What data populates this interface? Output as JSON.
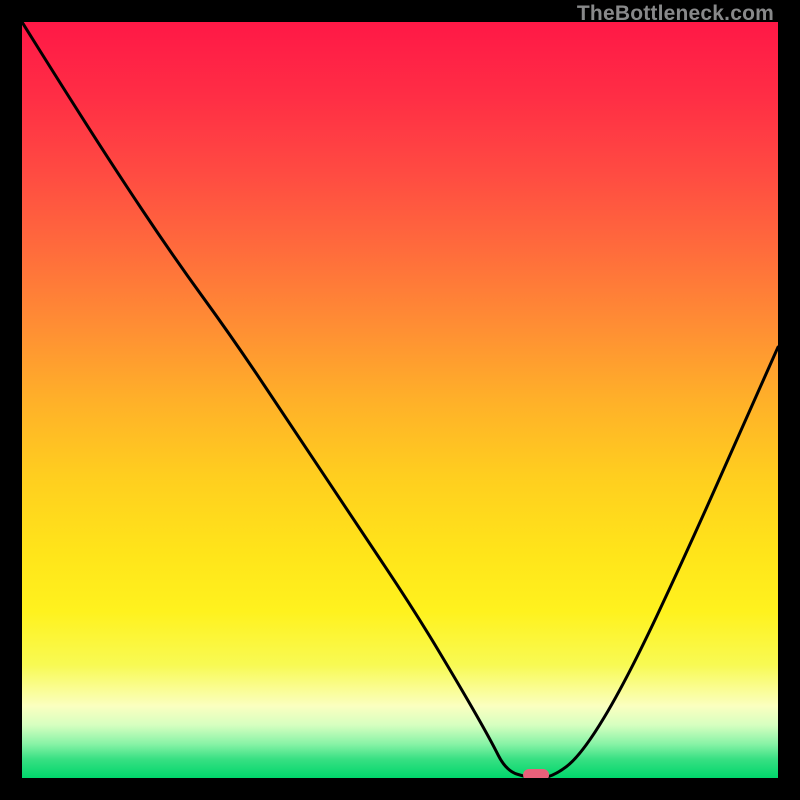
{
  "watermark": "TheBottleneck.com",
  "chart_data": {
    "type": "line",
    "title": "",
    "xlabel": "",
    "ylabel": "",
    "xlim": [
      0,
      100
    ],
    "ylim": [
      0,
      100
    ],
    "x": [
      0,
      5,
      12,
      20,
      28,
      36,
      44,
      52,
      58,
      62,
      64,
      67,
      70,
      74,
      80,
      88,
      96,
      100
    ],
    "values": [
      100,
      92,
      81,
      69,
      58,
      46,
      34,
      22,
      12,
      5,
      1,
      0,
      0,
      3,
      13,
      30,
      48,
      57
    ],
    "marker": {
      "x": 68,
      "y": 0
    },
    "gradient_stops": [
      {
        "offset": 0.0,
        "color": "#ff1846"
      },
      {
        "offset": 0.1,
        "color": "#ff2e45"
      },
      {
        "offset": 0.2,
        "color": "#ff4b42"
      },
      {
        "offset": 0.3,
        "color": "#ff6b3c"
      },
      {
        "offset": 0.4,
        "color": "#ff8d34"
      },
      {
        "offset": 0.5,
        "color": "#ffb029"
      },
      {
        "offset": 0.6,
        "color": "#ffce1f"
      },
      {
        "offset": 0.7,
        "color": "#ffe41a"
      },
      {
        "offset": 0.78,
        "color": "#fff21e"
      },
      {
        "offset": 0.85,
        "color": "#f8fa53"
      },
      {
        "offset": 0.905,
        "color": "#fbffc0"
      },
      {
        "offset": 0.93,
        "color": "#d6ffc0"
      },
      {
        "offset": 0.955,
        "color": "#88f3a6"
      },
      {
        "offset": 0.975,
        "color": "#38e083"
      },
      {
        "offset": 1.0,
        "color": "#00d66b"
      }
    ]
  }
}
